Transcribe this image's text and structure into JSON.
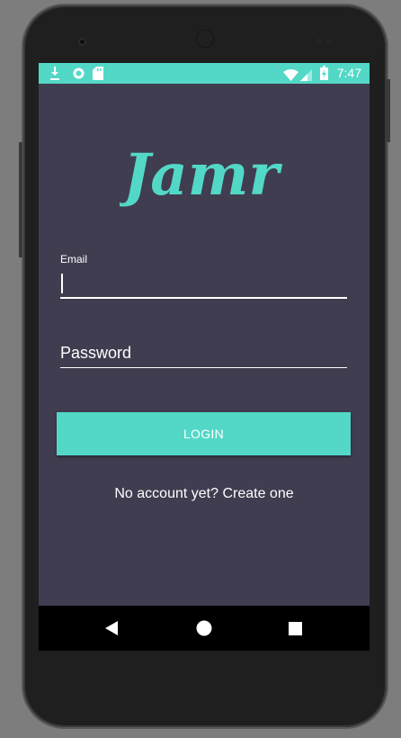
{
  "status_bar": {
    "time": "7:47",
    "icons": [
      "download-icon",
      "sync-icon",
      "sd-card-icon",
      "wifi-icon",
      "signal-icon",
      "battery-icon"
    ],
    "background": "#53d8c7"
  },
  "app": {
    "logo_text": "Jamr",
    "logo_color": "#53d8c7",
    "background": "#403d50"
  },
  "login_form": {
    "email_label": "Email",
    "email_value": "",
    "password_placeholder": "Password",
    "login_button_label": "LOGIN",
    "signup_prompt": "No account yet? Create one"
  },
  "nav_bar": {
    "icons": [
      "back-icon",
      "home-icon",
      "recents-icon"
    ]
  }
}
